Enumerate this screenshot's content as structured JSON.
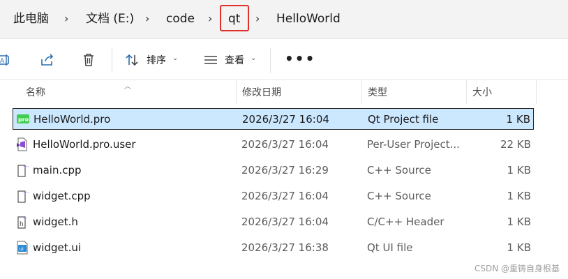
{
  "breadcrumb": {
    "items": [
      "此电脑",
      "文档 (E:)",
      "code",
      "qt",
      "HelloWorld"
    ]
  },
  "toolbar": {
    "sort_label": "排序",
    "view_label": "查看",
    "more_label": "•••"
  },
  "columns": {
    "name": "名称",
    "date": "修改日期",
    "type": "类型",
    "size": "大小"
  },
  "files": [
    {
      "name": "HelloWorld.pro",
      "date": "2026/3/27 16:04",
      "type": "Qt Project file",
      "size": "1 KB",
      "icon": "pro-file-icon",
      "selected": true
    },
    {
      "name": "HelloWorld.pro.user",
      "date": "2026/3/27 16:04",
      "type": "Per-User Project...",
      "size": "22 KB",
      "icon": "user-file-icon"
    },
    {
      "name": "main.cpp",
      "date": "2026/3/27 16:29",
      "type": "C++ Source",
      "size": "1 KB",
      "icon": "cpp-file-icon"
    },
    {
      "name": "widget.cpp",
      "date": "2026/3/27 16:04",
      "type": "C++ Source",
      "size": "1 KB",
      "icon": "cpp-file-icon"
    },
    {
      "name": "widget.h",
      "date": "2026/3/27 16:04",
      "type": "C/C++ Header",
      "size": "1 KB",
      "icon": "header-file-icon"
    },
    {
      "name": "widget.ui",
      "date": "2026/3/27 16:38",
      "type": "Qt UI file",
      "size": "1 KB",
      "icon": "ui-file-icon"
    }
  ],
  "watermark": "CSDN @重铸自身根基",
  "colors": {
    "selection_bg": "#cce8ff",
    "highlight_box": "#e0302a",
    "qt_green": "#41cd52"
  }
}
